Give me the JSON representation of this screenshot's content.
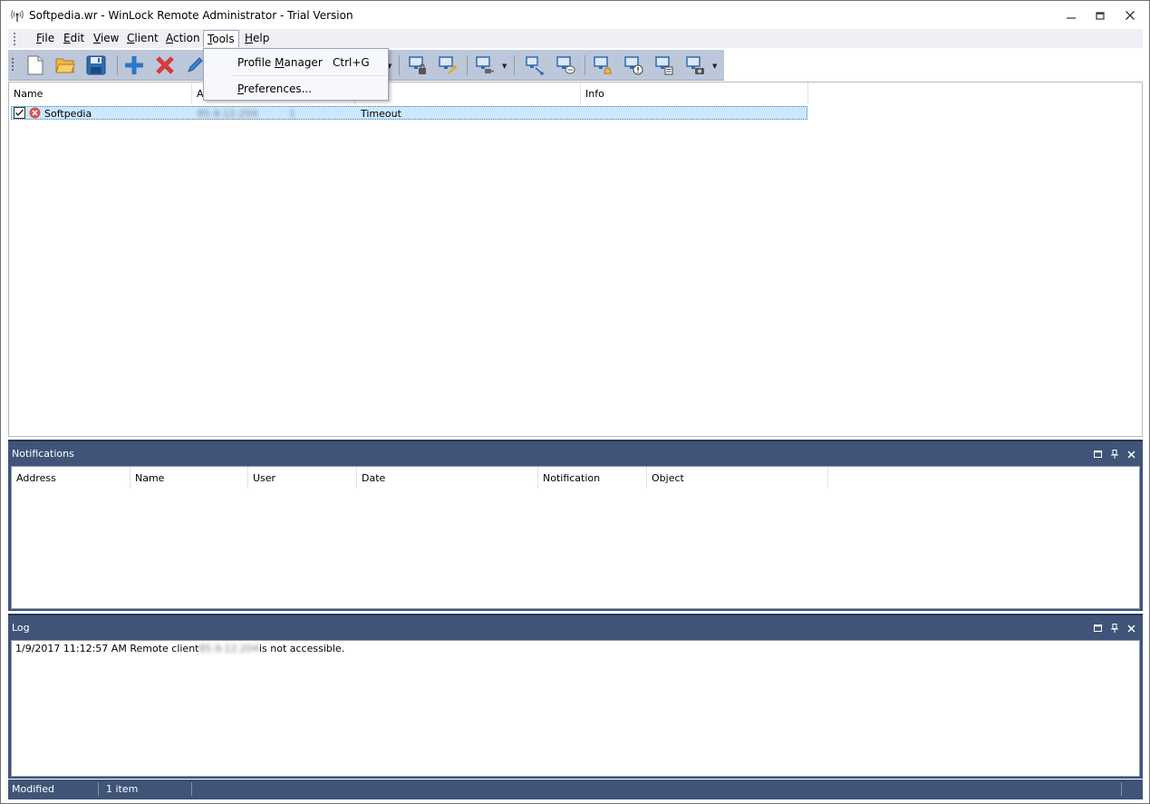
{
  "window": {
    "title": "Softpedia.wr - WinLock Remote Administrator - Trial Version"
  },
  "menu": {
    "file": {
      "pre": "",
      "u": "F",
      "post": "ile"
    },
    "edit": {
      "pre": "",
      "u": "E",
      "post": "dit"
    },
    "view": {
      "pre": "",
      "u": "V",
      "post": "iew"
    },
    "client": {
      "pre": "",
      "u": "C",
      "post": "lient"
    },
    "action": {
      "pre": "",
      "u": "A",
      "post": "ction"
    },
    "tools": {
      "pre": "",
      "u": "T",
      "post": "ools"
    },
    "help": {
      "pre": "",
      "u": "H",
      "post": "elp"
    }
  },
  "tools_menu": {
    "profile_manager": {
      "pre": "Profile ",
      "u": "M",
      "post": "anager"
    },
    "profile_manager_shortcut": "Ctrl+G",
    "preferences": {
      "pre": "",
      "u": "P",
      "post": "references..."
    }
  },
  "clients": {
    "columns": {
      "name": "Name",
      "address": "Ad",
      "info": "Info"
    },
    "rows": [
      {
        "name": "Softpedia",
        "address": "85.9.12.204",
        "address_tail": "1",
        "status": "Timeout",
        "info": ""
      }
    ]
  },
  "notifications": {
    "title": "Notifications",
    "columns": [
      "Address",
      "Name",
      "User",
      "Date",
      "Notification",
      "Object"
    ]
  },
  "log": {
    "title": "Log",
    "entries": [
      {
        "time": "1/9/2017 11:12:57 AM",
        "prefix": "Remote client",
        "address": "85.9.12.204",
        "suffix": "is not accessible."
      }
    ]
  },
  "status": {
    "state": "Modified",
    "count": "1 item"
  },
  "colors": {
    "panel_header": "#3f5478",
    "toolbar": "#bcc7d9",
    "selection": "#cce8ff",
    "error_icon": "#d9534f"
  },
  "icons": {
    "app": "antenna-icon",
    "new": "new-document-icon",
    "open": "open-folder-icon",
    "save": "save-disk-icon",
    "add": "plus-icon",
    "delete": "red-x-icon",
    "edit": "pencil-icon"
  }
}
